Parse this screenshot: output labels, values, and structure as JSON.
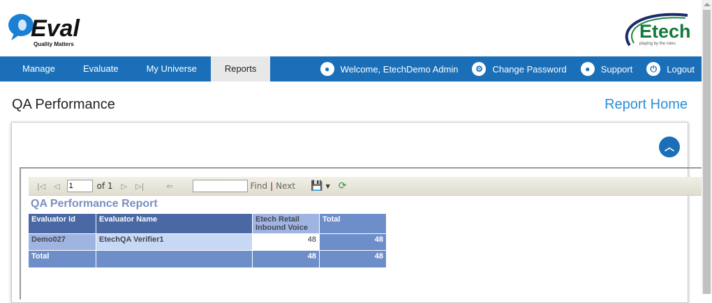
{
  "header": {
    "logo_text": "Q-Eval",
    "logo_tagline": "Quality Matters",
    "brand_text": "Etech",
    "brand_tagline": "playing by the rules"
  },
  "nav": {
    "items": [
      {
        "label": "Manage"
      },
      {
        "label": "Evaluate"
      },
      {
        "label": "My Universe"
      },
      {
        "label": "Reports"
      }
    ],
    "right": {
      "welcome": "Welcome, EtechDemo Admin",
      "change_password": "Change Password",
      "support": "Support",
      "logout": "Logout"
    }
  },
  "page": {
    "title": "QA Performance",
    "report_home": "Report Home"
  },
  "toolbar": {
    "page_value": "1",
    "of_label": "of 1",
    "find_placeholder": "",
    "find": "Find",
    "separator": "|",
    "next": "Next"
  },
  "report": {
    "title": "QA Performance Report",
    "headers": [
      "Evaluator Id",
      "Evaluator Name",
      "Etech Retail Inbound Voice",
      "Total"
    ],
    "rows": [
      [
        "Demo027",
        "EtechQA Verifier1",
        "48",
        "48"
      ]
    ],
    "total": [
      "Total",
      "",
      "48",
      "48"
    ]
  }
}
